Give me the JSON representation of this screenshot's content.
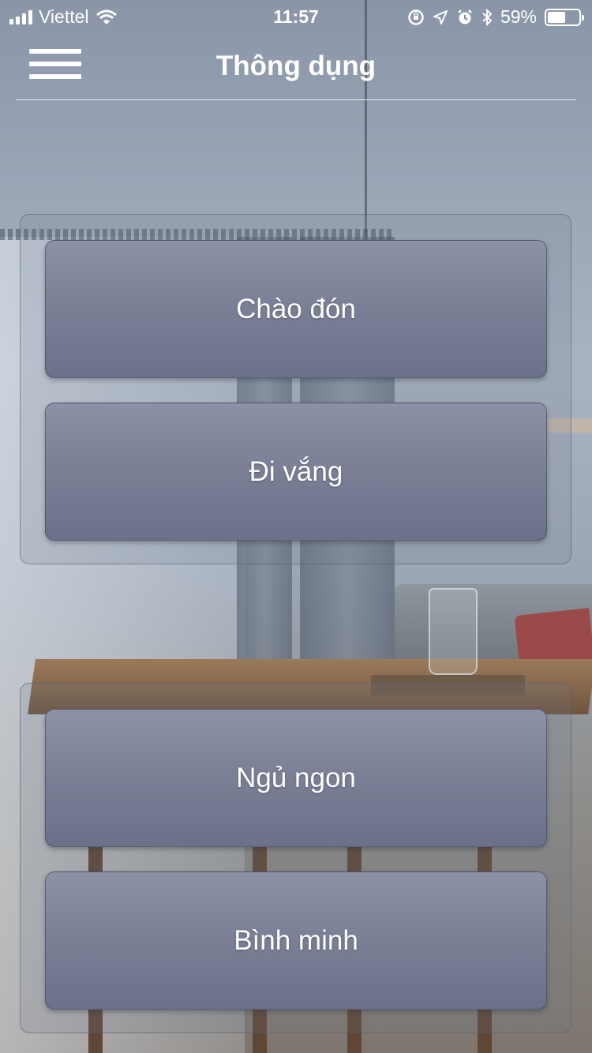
{
  "status_bar": {
    "carrier": "Viettel",
    "time": "11:57",
    "battery_percent": "59%",
    "battery_level": 0.59,
    "icons": [
      "signal-icon",
      "wifi-icon",
      "orientation-lock-icon",
      "location-icon",
      "alarm-icon",
      "bluetooth-icon",
      "battery-icon"
    ]
  },
  "nav": {
    "title": "Thông dụng",
    "menu_icon": "hamburger-menu-icon"
  },
  "groups": [
    {
      "buttons": [
        {
          "label": "Chào đón"
        },
        {
          "label": "Đi vắng"
        }
      ]
    },
    {
      "buttons": [
        {
          "label": "Ngủ ngon"
        },
        {
          "label": "Bình minh"
        }
      ]
    }
  ],
  "colors": {
    "button_top": "#8d91a7",
    "button_bottom": "#6c7189",
    "text": "#ffffff"
  }
}
